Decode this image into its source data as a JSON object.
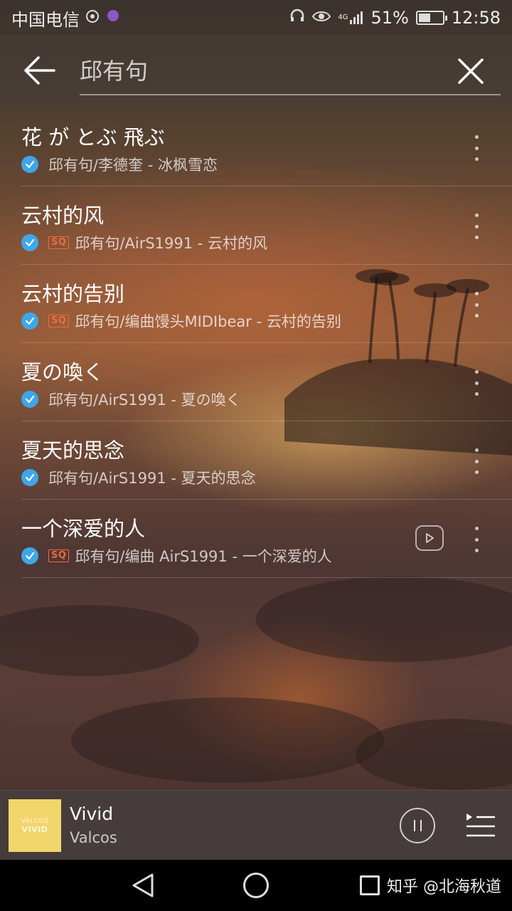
{
  "status_bar": {
    "carrier": "中国电信",
    "network": "4G",
    "battery": "51%",
    "time": "12:58",
    "battery_level": 0.51
  },
  "search": {
    "query": "邱有句"
  },
  "songs": [
    {
      "title": "花 が とぶ 飛ぶ",
      "meta": "邱有句/李德奎 - 冰枫雪恋",
      "sq": false,
      "mv": false
    },
    {
      "title": "云村的风",
      "meta": "邱有句/AirS1991 - 云村的风",
      "sq": true,
      "mv": false
    },
    {
      "title": "云村的告别",
      "meta": "邱有句/编曲馒头MIDIbear - 云村的告别",
      "sq": true,
      "mv": false
    },
    {
      "title": "夏の喚く",
      "meta": "邱有句/AirS1991 - 夏の喚く",
      "sq": false,
      "mv": false
    },
    {
      "title": "夏天的思念",
      "meta": "邱有句/AirS1991 - 夏天的思念",
      "sq": false,
      "mv": false
    },
    {
      "title": "一个深爱的人",
      "meta": "邱有句/编曲 AirS1991 - 一个深爱的人",
      "sq": true,
      "mv": true
    }
  ],
  "sq_label": "SQ",
  "now_playing": {
    "title": "Vivid",
    "artist": "Valcos",
    "art_text_top": "VALCOS",
    "art_text_bottom": "VIVID",
    "art_color": "#f2d56b"
  },
  "watermark": "知乎 @北海秋道",
  "colors": {
    "check": "#3fa6e8",
    "sq": "#f06a3e"
  }
}
